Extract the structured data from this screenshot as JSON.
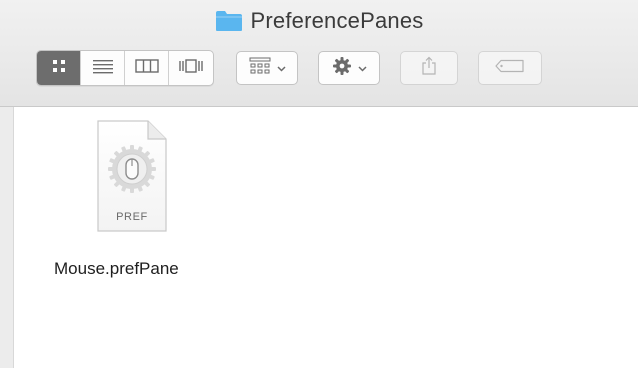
{
  "window": {
    "title": "PreferencePanes",
    "title_icon": "folder-icon"
  },
  "toolbar": {
    "view_modes": [
      {
        "name": "icon-view",
        "icon": "grid-icon",
        "active": true
      },
      {
        "name": "list-view",
        "icon": "list-icon",
        "active": false
      },
      {
        "name": "column-view",
        "icon": "columns-icon",
        "active": false
      },
      {
        "name": "cover-flow-view",
        "icon": "coverflow-icon",
        "active": false
      }
    ],
    "arrange_icon": "arrange-grid-icon",
    "action_icon": "gear-icon",
    "share_icon": "share-icon",
    "tag_icon": "tag-icon"
  },
  "files": [
    {
      "name": "Mouse.prefPane",
      "badge": "PREF",
      "icon": "pref-document-icon"
    }
  ],
  "colors": {
    "folder": "#5ab6ef",
    "active_segment": "#6d6d6d",
    "toolbar_bg": "#e9e9e9"
  }
}
